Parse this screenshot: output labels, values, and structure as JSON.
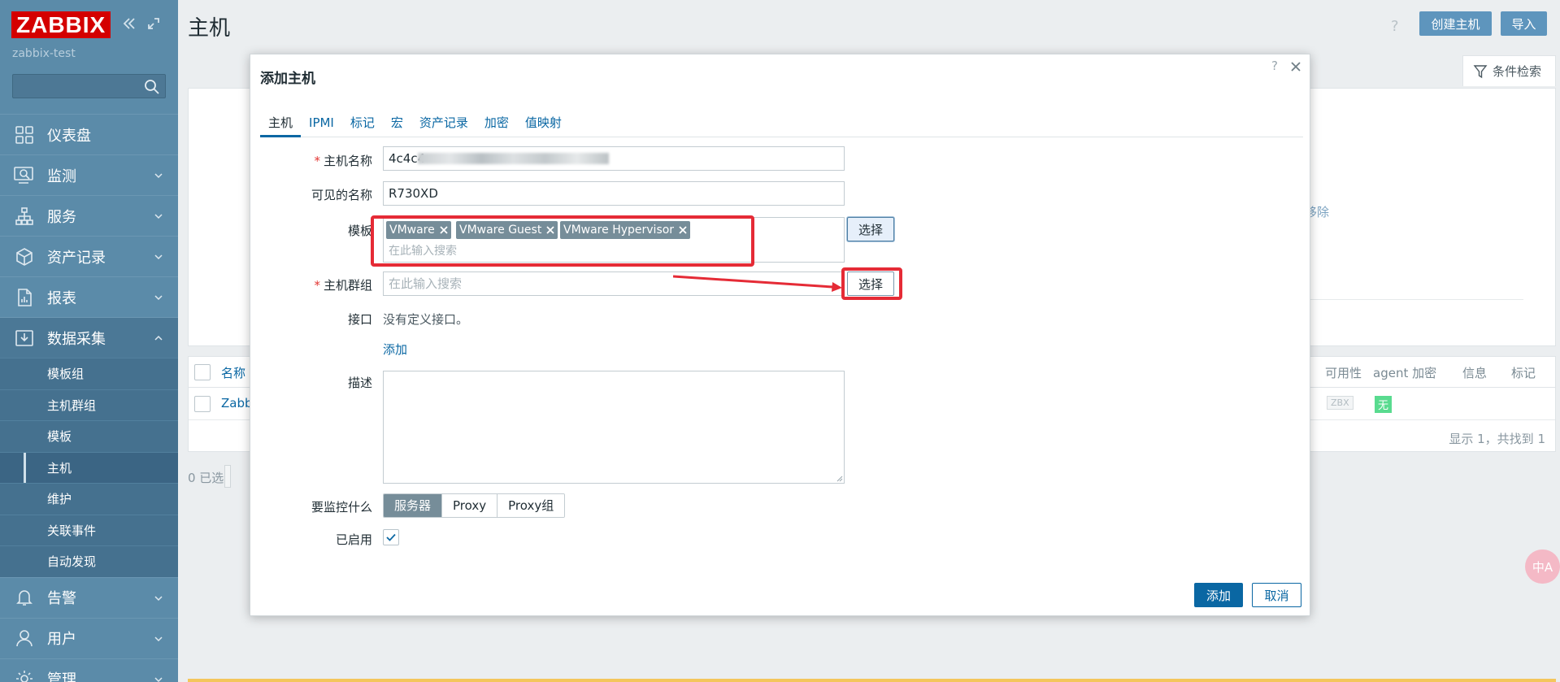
{
  "sidebar": {
    "logo": "ZABBIX",
    "server_name": "zabbix-test",
    "menu": {
      "dashboard": "仪表盘",
      "monitoring": "监测",
      "services": "服务",
      "inventory": "资产记录",
      "reports": "报表",
      "data_collection": "数据采集",
      "alerts": "告警",
      "users": "用户",
      "administration": "管理"
    },
    "submenu": [
      "模板组",
      "主机群组",
      "模板",
      "主机",
      "维护",
      "关联事件",
      "自动发现"
    ]
  },
  "header": {
    "title": "主机",
    "help": "?",
    "create_host": "创建主机",
    "import": "导入",
    "filter": "条件检索"
  },
  "background": {
    "partial_link": "移除",
    "table": {
      "columns": {
        "name": "名称",
        "availability": "可用性",
        "agent_encryption": "agent 加密",
        "info": "信息",
        "tags": "标记"
      },
      "rows": [
        {
          "name": "Zabb",
          "interface_badge": "ZBX",
          "encryption": "无"
        }
      ],
      "footer": "显示 1，共找到 1"
    },
    "selected": "0 已选",
    "translate_badge": "中A"
  },
  "dialog": {
    "title": "添加主机",
    "help": "?",
    "tabs": [
      "主机",
      "IPMI",
      "标记",
      "宏",
      "资产记录",
      "加密",
      "值映射"
    ],
    "form": {
      "host_name_label": "主机名称",
      "host_name_value": "4c4c4",
      "visible_name_label": "可见的名称",
      "visible_name_value": "R730XD",
      "templates_label": "模板",
      "templates": [
        "VMware",
        "VMware Guest",
        "VMware Hypervisor"
      ],
      "templates_search_placeholder": "在此输入搜索",
      "select_button": "选择",
      "host_groups_label": "主机群组",
      "host_groups_placeholder": "在此输入搜索",
      "interfaces_label": "接口",
      "interfaces_empty": "没有定义接口。",
      "add_interface": "添加",
      "description_label": "描述",
      "monitored_by_label": "要监控什么",
      "monitored_by_options": [
        "服务器",
        "Proxy",
        "Proxy组"
      ],
      "monitored_by_selected": "服务器",
      "enabled_label": "已启用",
      "enabled": true
    },
    "buttons": {
      "add": "添加",
      "cancel": "取消"
    }
  },
  "colors": {
    "sidebar": "#5b8ba9",
    "logo_red": "#d40000",
    "link_blue": "#0a67a3",
    "annotation_red": "#e52b36",
    "chip": "#768d99"
  }
}
